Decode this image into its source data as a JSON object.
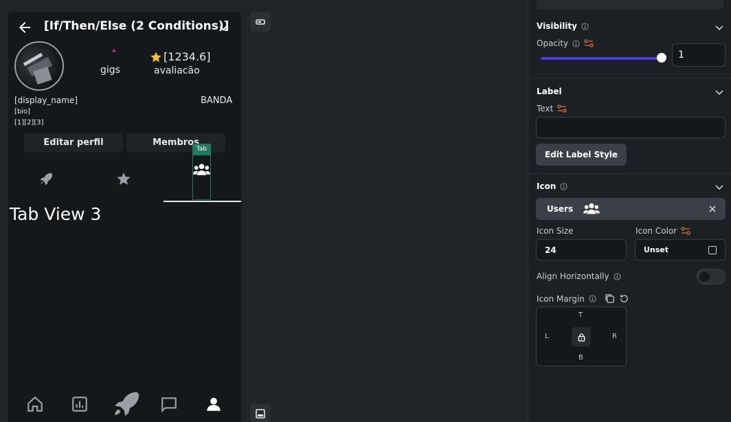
{
  "preview": {
    "title": "[If/Then/Else (2 Conditions)]",
    "gigs_label": "gigs",
    "rating_value": "[1234.6]",
    "rating_label": "avaliacão",
    "display_name": "[display_name]",
    "band_label": "BANDA",
    "bio": "[bio]",
    "numbers": "[1][2][3]",
    "edit_profile_button": "Editar perfil",
    "members_button": "Membros",
    "tab_badge": "Tab",
    "tab_view_text": "Tab View 3",
    "colors": {
      "background": "#14181b",
      "star": "#f5c518",
      "dot": "#c81ea8",
      "tab_selection": "#1f7a5e"
    }
  },
  "panel": {
    "visibility": {
      "title": "Visibility",
      "opacity_label": "Opacity",
      "opacity_value": "1",
      "opacity_fraction": 1.0,
      "slider_color": "#4b3de6"
    },
    "label": {
      "title": "Label",
      "text_label": "Text",
      "text_value": "",
      "edit_style_button": "Edit Label Style"
    },
    "icon": {
      "title": "Icon",
      "selected_icon": "Users",
      "icon_size_label": "Icon Size",
      "icon_size_value": "24",
      "icon_color_label": "Icon Color",
      "icon_color_value": "Unset",
      "align_label": "Align Horizontally",
      "align_enabled": false,
      "margin_label": "Icon Margin",
      "margin_top": "T",
      "margin_left": "L",
      "margin_right": "R",
      "margin_bottom": "B"
    },
    "accent_color": "#e07b39"
  }
}
